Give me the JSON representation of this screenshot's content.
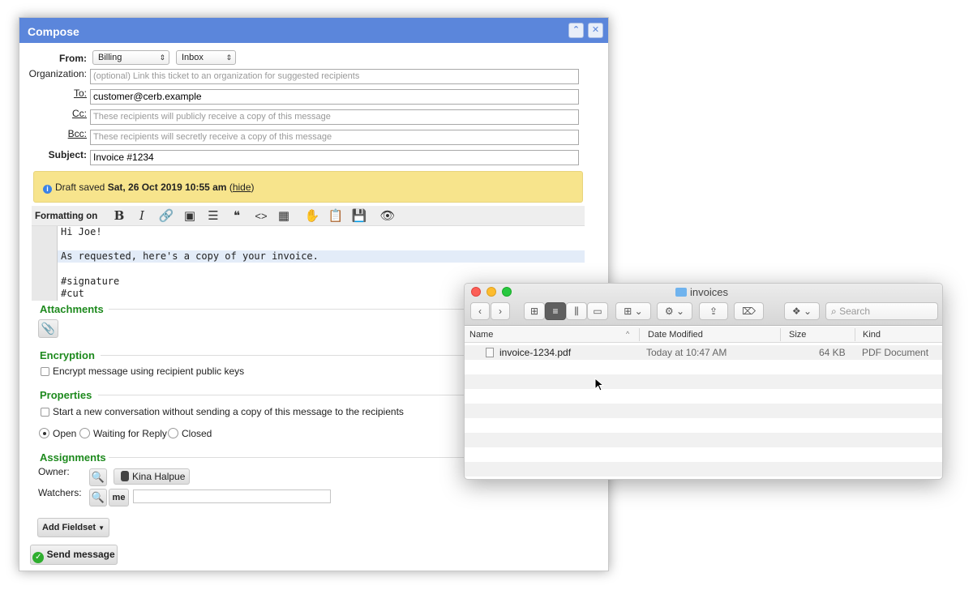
{
  "compose": {
    "title": "Compose",
    "from_label": "From:",
    "from_value": "Billing",
    "from_bucket": "Inbox",
    "org_label": "Organization:",
    "org_placeholder": "(optional) Link this ticket to an organization for suggested recipients",
    "to_label": "To:",
    "to_value": "customer@cerb.example",
    "cc_label": "Cc:",
    "cc_placeholder": "These recipients will publicly receive a copy of this message",
    "bcc_label": "Bcc:",
    "bcc_placeholder": "These recipients will secretly receive a copy of this message",
    "subject_label": "Subject:",
    "subject_value": "Invoice #1234",
    "draft": {
      "prefix": "Draft saved",
      "date": "Sat, 26 Oct 2019 10:55 am",
      "open_paren": "(",
      "hide": "hide",
      "close_paren": ")"
    },
    "formatting_label": "Formatting on",
    "editor_lines": [
      "Hi Joe!",
      "",
      "As requested, here's a copy of your invoice.",
      "",
      "#signature",
      "#cut"
    ],
    "attachments_title": "Attachments",
    "encryption_title": "Encryption",
    "encrypt_label": "Encrypt message using recipient public keys",
    "properties_title": "Properties",
    "new_conv_label": "Start a new conversation without sending a copy of this message to the recipients",
    "status_open": "Open",
    "status_waiting": "Waiting for Reply",
    "status_closed": "Closed",
    "assignments_title": "Assignments",
    "owner_label": "Owner:",
    "owner_value": "Kina Halpue",
    "watchers_label": "Watchers:",
    "me_label": "me",
    "add_fieldset": "Add Fieldset",
    "send_message": "Send message"
  },
  "finder": {
    "title": "invoices",
    "search_placeholder": "Search",
    "columns": [
      "Name",
      "Date Modified",
      "Size",
      "Kind"
    ],
    "files": [
      {
        "name": "invoice-1234.pdf",
        "modified": "Today at 10:47 AM",
        "size": "64 KB",
        "kind": "PDF Document"
      }
    ]
  },
  "colors": {
    "compose_title_bg": "#5b86db",
    "section_green": "#1e8a1e",
    "draft_bg": "#f7e48c"
  }
}
